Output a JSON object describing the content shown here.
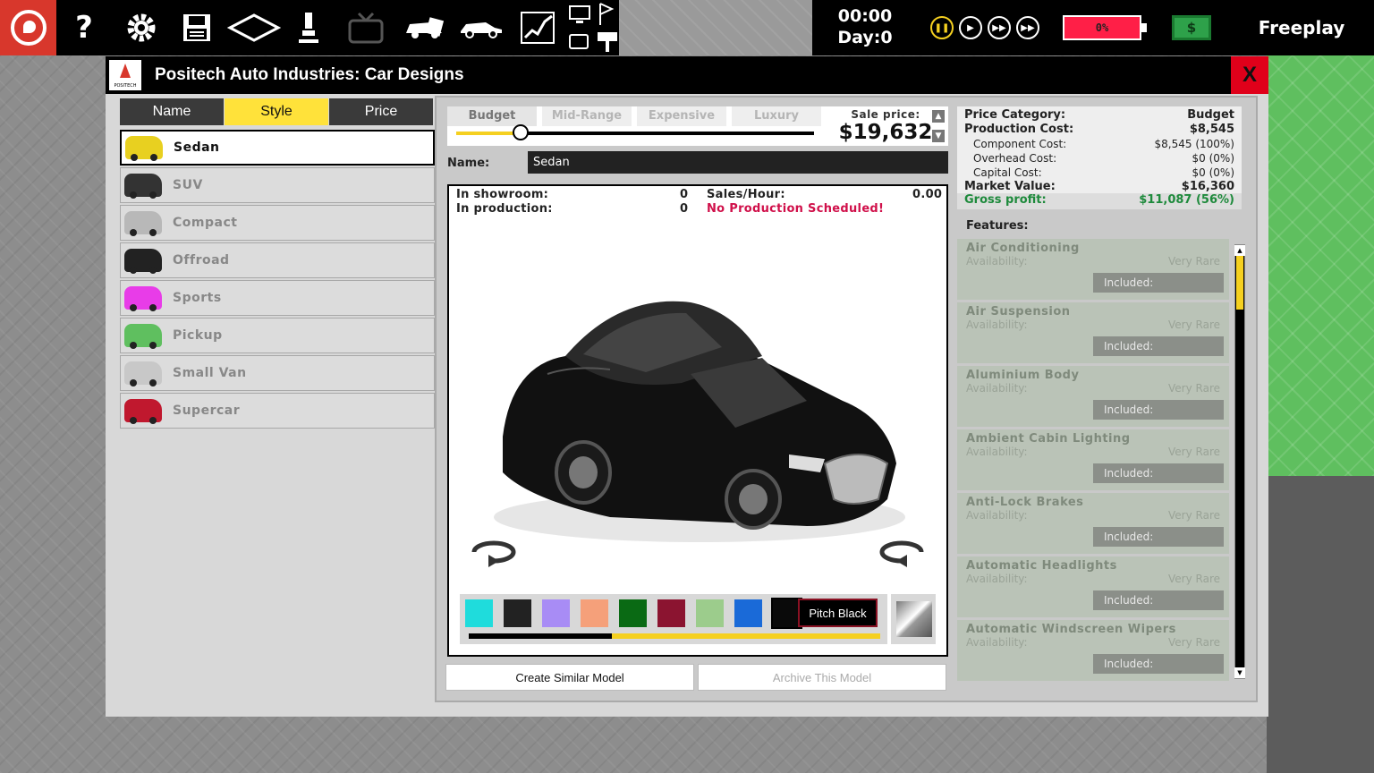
{
  "topbar": {
    "time": "00:00",
    "day": "Day:0",
    "battery": "0%",
    "money_symbol": "$",
    "mode": "Freeplay",
    "icons": [
      "logo-icon",
      "help-icon",
      "settings-icon",
      "save-icon",
      "map-icon",
      "research-icon",
      "tv-icon",
      "car-sale-icon",
      "car-icon",
      "chart-icon",
      "monitor-icon",
      "flag-icon"
    ]
  },
  "window": {
    "title": "Positech Auto Industries: Car Designs",
    "close": "X",
    "logo_text": "POSITECH"
  },
  "sort_tabs": [
    "Name",
    "Style",
    "Price"
  ],
  "models": [
    {
      "name": "Sedan",
      "color": "#e8d020"
    },
    {
      "name": "SUV",
      "color": "#333333"
    },
    {
      "name": "Compact",
      "color": "#b8b8b8"
    },
    {
      "name": "Offroad",
      "color": "#222222"
    },
    {
      "name": "Sports",
      "color": "#e83ce8"
    },
    {
      "name": "Pickup",
      "color": "#5fbf5f"
    },
    {
      "name": "Small Van",
      "color": "#c8c8c8"
    },
    {
      "name": "Supercar",
      "color": "#c0182e"
    }
  ],
  "price_slider": {
    "tiers": [
      "Budget",
      "Mid-Range",
      "Expensive",
      "Luxury"
    ],
    "position": 0.18,
    "sale_label": "Sale price:",
    "sale_price": "$19,632"
  },
  "name_field": {
    "label": "Name:",
    "value": "Sedan"
  },
  "stats": {
    "showroom_label": "In showroom:",
    "showroom_value": "0",
    "production_label": "In production:",
    "production_value": "0",
    "sales_label": "Sales/Hour:",
    "sales_value": "0.00",
    "production_status": "No Production Scheduled!"
  },
  "swatches": [
    "#1fdcdc",
    "#222222",
    "#a88cf5",
    "#f5a07a",
    "#0a6a14",
    "#8b1430",
    "#9ccc8c",
    "#1a6ad8",
    "#0a0a0a",
    "#d020c8",
    "#c818c8"
  ],
  "tooltip": "Pitch Black",
  "actions": {
    "create": "Create Similar Model",
    "archive": "Archive This Model"
  },
  "info": {
    "price_category_label": "Price Category:",
    "price_category": "Budget",
    "production_cost_label": "Production Cost:",
    "production_cost": "$8,545",
    "component_label": "Component Cost:",
    "component": "$8,545 (100%)",
    "overhead_label": "Overhead Cost:",
    "overhead": "$0 (0%)",
    "capital_label": "Capital Cost:",
    "capital": "$0 (0%)",
    "market_label": "Market Value:",
    "market": "$16,360",
    "gross_label": "Gross profit:",
    "gross": "$11,087 (56%)"
  },
  "features_title": "Features:",
  "features": [
    {
      "name": "Air Conditioning",
      "avail_label": "Availability:",
      "avail": "Very Rare",
      "status": "Included:"
    },
    {
      "name": "Air Suspension",
      "avail_label": "Availability:",
      "avail": "Very Rare",
      "status": "Included:"
    },
    {
      "name": "Aluminium Body",
      "avail_label": "Availability:",
      "avail": "Very Rare",
      "status": "Included:"
    },
    {
      "name": "Ambient Cabin Lighting",
      "avail_label": "Availability:",
      "avail": "Very Rare",
      "status": "Included:"
    },
    {
      "name": "Anti-Lock Brakes",
      "avail_label": "Availability:",
      "avail": "Very Rare",
      "status": "Included:"
    },
    {
      "name": "Automatic Headlights",
      "avail_label": "Availability:",
      "avail": "Very Rare",
      "status": "Included:"
    },
    {
      "name": "Automatic Windscreen Wipers",
      "avail_label": "Availability:",
      "avail": "Very Rare",
      "status": "Included:"
    }
  ]
}
